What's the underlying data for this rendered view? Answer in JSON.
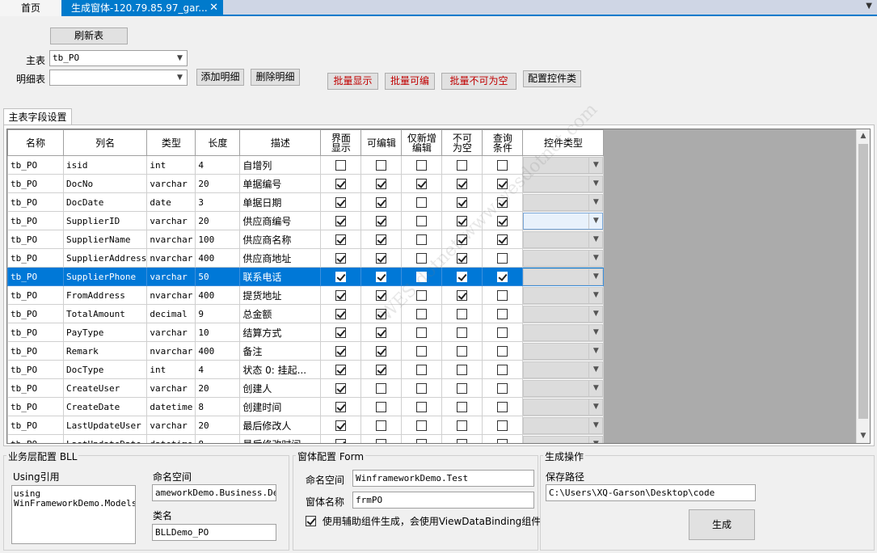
{
  "tabs": {
    "home": "首页",
    "active": "生成窗体-120.79.85.97_gar...",
    "close": "✕",
    "menu": "▼"
  },
  "toolbar": {
    "refresh": "刷新表",
    "main_table_label": "主表",
    "main_table_value": "tb_PO",
    "detail_table_label": "明细表",
    "detail_table_value": "",
    "add_detail": "添加明细",
    "delete_detail": "删除明细",
    "batch_show": "批量显示",
    "batch_edit": "批量可编",
    "batch_notnull": "批量不可为空",
    "config_control": "配置控件类"
  },
  "field_settings_tab": "主表字段设置",
  "grid": {
    "headers": {
      "name": "名称",
      "column": "列名",
      "type": "类型",
      "length": "长度",
      "desc": "描述",
      "show1": "界面",
      "show2": "显示",
      "editable": "可编辑",
      "newedit1": "仅新增",
      "newedit2": "编辑",
      "notnull1": "不可",
      "notnull2": "为空",
      "query1": "查询",
      "query2": "条件",
      "control": "控件类型"
    },
    "rows": [
      {
        "name": "tb_PO",
        "col": "isid",
        "type": "int",
        "len": "4",
        "desc": "自增列",
        "c": [
          0,
          0,
          0,
          0,
          0
        ]
      },
      {
        "name": "tb_PO",
        "col": "DocNo",
        "type": "varchar",
        "len": "20",
        "desc": "单据编号",
        "c": [
          1,
          1,
          1,
          1,
          1
        ]
      },
      {
        "name": "tb_PO",
        "col": "DocDate",
        "type": "date",
        "len": "3",
        "desc": "单据日期",
        "c": [
          1,
          1,
          0,
          1,
          1
        ]
      },
      {
        "name": "tb_PO",
        "col": "SupplierID",
        "type": "varchar",
        "len": "20",
        "desc": "供应商编号",
        "c": [
          1,
          1,
          0,
          1,
          1
        ]
      },
      {
        "name": "tb_PO",
        "col": "SupplierName",
        "type": "nvarchar",
        "len": "100",
        "desc": "供应商名称",
        "c": [
          1,
          1,
          0,
          1,
          1
        ]
      },
      {
        "name": "tb_PO",
        "col": "SupplierAddress",
        "type": "nvarchar",
        "len": "400",
        "desc": "供应商地址",
        "c": [
          1,
          1,
          0,
          1,
          0
        ]
      },
      {
        "name": "tb_PO",
        "col": "SupplierPhone",
        "type": "varchar",
        "len": "50",
        "desc": "联系电话",
        "c": [
          1,
          1,
          0,
          1,
          1
        ]
      },
      {
        "name": "tb_PO",
        "col": "FromAddress",
        "type": "nvarchar",
        "len": "400",
        "desc": "提货地址",
        "c": [
          1,
          1,
          0,
          1,
          0
        ]
      },
      {
        "name": "tb_PO",
        "col": "TotalAmount",
        "type": "decimal",
        "len": "9",
        "desc": "总金额",
        "c": [
          1,
          1,
          0,
          0,
          0
        ]
      },
      {
        "name": "tb_PO",
        "col": "PayType",
        "type": "varchar",
        "len": "10",
        "desc": "结算方式",
        "c": [
          1,
          1,
          0,
          0,
          0
        ]
      },
      {
        "name": "tb_PO",
        "col": "Remark",
        "type": "nvarchar",
        "len": "400",
        "desc": "备注",
        "c": [
          1,
          1,
          0,
          0,
          0
        ]
      },
      {
        "name": "tb_PO",
        "col": "DocType",
        "type": "int",
        "len": "4",
        "desc": "状态 0: 挂起...",
        "c": [
          1,
          1,
          0,
          0,
          0
        ]
      },
      {
        "name": "tb_PO",
        "col": "CreateUser",
        "type": "varchar",
        "len": "20",
        "desc": "创建人",
        "c": [
          1,
          0,
          0,
          0,
          0
        ]
      },
      {
        "name": "tb_PO",
        "col": "CreateDate",
        "type": "datetime",
        "len": "8",
        "desc": "创建时间",
        "c": [
          1,
          0,
          0,
          0,
          0
        ]
      },
      {
        "name": "tb_PO",
        "col": "LastUpdateUser",
        "type": "varchar",
        "len": "20",
        "desc": "最后修改人",
        "c": [
          1,
          0,
          0,
          0,
          0
        ]
      },
      {
        "name": "tb_PO",
        "col": "LastUpdateDate",
        "type": "datetime",
        "len": "8",
        "desc": "最后修改时间",
        "c": [
          1,
          0,
          0,
          0,
          0
        ]
      }
    ],
    "selected_row": 6,
    "focus_row": 3,
    "scroll_up": "▲",
    "scroll_down": "▼"
  },
  "bll": {
    "title": "业务层配置 BLL",
    "using_label": "Using引用",
    "using_value": "using\nWinFrameworkDemo.Models;",
    "namespace_label": "命名空间",
    "namespace_value": "ameworkDemo.Business.Demo",
    "class_label": "类名",
    "class_value": "BLLDemo_PO"
  },
  "form": {
    "title": "窗体配置 Form",
    "namespace_label": "命名空间",
    "namespace_value": "WinframeworkDemo.Test",
    "name_label": "窗体名称",
    "name_value": "frmPO",
    "helper_label": "使用辅助组件生成，会使用ViewDataBinding组件",
    "helper_checked": true
  },
  "gen": {
    "title": "生成操作",
    "path_label": "保存路径",
    "path_value": "C:\\Users\\XQ-Garson\\Desktop\\code",
    "generate": "生成"
  },
  "watermark": "WES dotnet  www.wesdotnet.com"
}
